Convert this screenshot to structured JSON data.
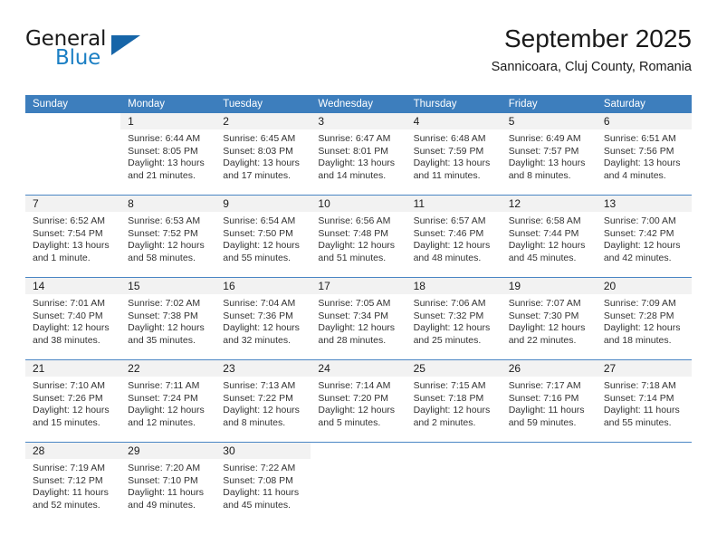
{
  "brand": {
    "word1": "General",
    "word2": "Blue",
    "logo_icon": "blue-triangle-icon",
    "accent_color": "#1b7fc4"
  },
  "header": {
    "title": "September 2025",
    "subtitle": "Sannicoara, Cluj County, Romania"
  },
  "calendar": {
    "header_color": "#3d7ebd",
    "weekdays": [
      "Sunday",
      "Monday",
      "Tuesday",
      "Wednesday",
      "Thursday",
      "Friday",
      "Saturday"
    ],
    "weeks": [
      [
        {
          "day": "",
          "sunrise": "",
          "sunset": "",
          "daylight_line1": "",
          "daylight_line2": ""
        },
        {
          "day": "1",
          "sunrise": "Sunrise: 6:44 AM",
          "sunset": "Sunset: 8:05 PM",
          "daylight_line1": "Daylight: 13 hours",
          "daylight_line2": "and 21 minutes."
        },
        {
          "day": "2",
          "sunrise": "Sunrise: 6:45 AM",
          "sunset": "Sunset: 8:03 PM",
          "daylight_line1": "Daylight: 13 hours",
          "daylight_line2": "and 17 minutes."
        },
        {
          "day": "3",
          "sunrise": "Sunrise: 6:47 AM",
          "sunset": "Sunset: 8:01 PM",
          "daylight_line1": "Daylight: 13 hours",
          "daylight_line2": "and 14 minutes."
        },
        {
          "day": "4",
          "sunrise": "Sunrise: 6:48 AM",
          "sunset": "Sunset: 7:59 PM",
          "daylight_line1": "Daylight: 13 hours",
          "daylight_line2": "and 11 minutes."
        },
        {
          "day": "5",
          "sunrise": "Sunrise: 6:49 AM",
          "sunset": "Sunset: 7:57 PM",
          "daylight_line1": "Daylight: 13 hours",
          "daylight_line2": "and 8 minutes."
        },
        {
          "day": "6",
          "sunrise": "Sunrise: 6:51 AM",
          "sunset": "Sunset: 7:56 PM",
          "daylight_line1": "Daylight: 13 hours",
          "daylight_line2": "and 4 minutes."
        }
      ],
      [
        {
          "day": "7",
          "sunrise": "Sunrise: 6:52 AM",
          "sunset": "Sunset: 7:54 PM",
          "daylight_line1": "Daylight: 13 hours",
          "daylight_line2": "and 1 minute."
        },
        {
          "day": "8",
          "sunrise": "Sunrise: 6:53 AM",
          "sunset": "Sunset: 7:52 PM",
          "daylight_line1": "Daylight: 12 hours",
          "daylight_line2": "and 58 minutes."
        },
        {
          "day": "9",
          "sunrise": "Sunrise: 6:54 AM",
          "sunset": "Sunset: 7:50 PM",
          "daylight_line1": "Daylight: 12 hours",
          "daylight_line2": "and 55 minutes."
        },
        {
          "day": "10",
          "sunrise": "Sunrise: 6:56 AM",
          "sunset": "Sunset: 7:48 PM",
          "daylight_line1": "Daylight: 12 hours",
          "daylight_line2": "and 51 minutes."
        },
        {
          "day": "11",
          "sunrise": "Sunrise: 6:57 AM",
          "sunset": "Sunset: 7:46 PM",
          "daylight_line1": "Daylight: 12 hours",
          "daylight_line2": "and 48 minutes."
        },
        {
          "day": "12",
          "sunrise": "Sunrise: 6:58 AM",
          "sunset": "Sunset: 7:44 PM",
          "daylight_line1": "Daylight: 12 hours",
          "daylight_line2": "and 45 minutes."
        },
        {
          "day": "13",
          "sunrise": "Sunrise: 7:00 AM",
          "sunset": "Sunset: 7:42 PM",
          "daylight_line1": "Daylight: 12 hours",
          "daylight_line2": "and 42 minutes."
        }
      ],
      [
        {
          "day": "14",
          "sunrise": "Sunrise: 7:01 AM",
          "sunset": "Sunset: 7:40 PM",
          "daylight_line1": "Daylight: 12 hours",
          "daylight_line2": "and 38 minutes."
        },
        {
          "day": "15",
          "sunrise": "Sunrise: 7:02 AM",
          "sunset": "Sunset: 7:38 PM",
          "daylight_line1": "Daylight: 12 hours",
          "daylight_line2": "and 35 minutes."
        },
        {
          "day": "16",
          "sunrise": "Sunrise: 7:04 AM",
          "sunset": "Sunset: 7:36 PM",
          "daylight_line1": "Daylight: 12 hours",
          "daylight_line2": "and 32 minutes."
        },
        {
          "day": "17",
          "sunrise": "Sunrise: 7:05 AM",
          "sunset": "Sunset: 7:34 PM",
          "daylight_line1": "Daylight: 12 hours",
          "daylight_line2": "and 28 minutes."
        },
        {
          "day": "18",
          "sunrise": "Sunrise: 7:06 AM",
          "sunset": "Sunset: 7:32 PM",
          "daylight_line1": "Daylight: 12 hours",
          "daylight_line2": "and 25 minutes."
        },
        {
          "day": "19",
          "sunrise": "Sunrise: 7:07 AM",
          "sunset": "Sunset: 7:30 PM",
          "daylight_line1": "Daylight: 12 hours",
          "daylight_line2": "and 22 minutes."
        },
        {
          "day": "20",
          "sunrise": "Sunrise: 7:09 AM",
          "sunset": "Sunset: 7:28 PM",
          "daylight_line1": "Daylight: 12 hours",
          "daylight_line2": "and 18 minutes."
        }
      ],
      [
        {
          "day": "21",
          "sunrise": "Sunrise: 7:10 AM",
          "sunset": "Sunset: 7:26 PM",
          "daylight_line1": "Daylight: 12 hours",
          "daylight_line2": "and 15 minutes."
        },
        {
          "day": "22",
          "sunrise": "Sunrise: 7:11 AM",
          "sunset": "Sunset: 7:24 PM",
          "daylight_line1": "Daylight: 12 hours",
          "daylight_line2": "and 12 minutes."
        },
        {
          "day": "23",
          "sunrise": "Sunrise: 7:13 AM",
          "sunset": "Sunset: 7:22 PM",
          "daylight_line1": "Daylight: 12 hours",
          "daylight_line2": "and 8 minutes."
        },
        {
          "day": "24",
          "sunrise": "Sunrise: 7:14 AM",
          "sunset": "Sunset: 7:20 PM",
          "daylight_line1": "Daylight: 12 hours",
          "daylight_line2": "and 5 minutes."
        },
        {
          "day": "25",
          "sunrise": "Sunrise: 7:15 AM",
          "sunset": "Sunset: 7:18 PM",
          "daylight_line1": "Daylight: 12 hours",
          "daylight_line2": "and 2 minutes."
        },
        {
          "day": "26",
          "sunrise": "Sunrise: 7:17 AM",
          "sunset": "Sunset: 7:16 PM",
          "daylight_line1": "Daylight: 11 hours",
          "daylight_line2": "and 59 minutes."
        },
        {
          "day": "27",
          "sunrise": "Sunrise: 7:18 AM",
          "sunset": "Sunset: 7:14 PM",
          "daylight_line1": "Daylight: 11 hours",
          "daylight_line2": "and 55 minutes."
        }
      ],
      [
        {
          "day": "28",
          "sunrise": "Sunrise: 7:19 AM",
          "sunset": "Sunset: 7:12 PM",
          "daylight_line1": "Daylight: 11 hours",
          "daylight_line2": "and 52 minutes."
        },
        {
          "day": "29",
          "sunrise": "Sunrise: 7:20 AM",
          "sunset": "Sunset: 7:10 PM",
          "daylight_line1": "Daylight: 11 hours",
          "daylight_line2": "and 49 minutes."
        },
        {
          "day": "30",
          "sunrise": "Sunrise: 7:22 AM",
          "sunset": "Sunset: 7:08 PM",
          "daylight_line1": "Daylight: 11 hours",
          "daylight_line2": "and 45 minutes."
        },
        {
          "day": "",
          "sunrise": "",
          "sunset": "",
          "daylight_line1": "",
          "daylight_line2": ""
        },
        {
          "day": "",
          "sunrise": "",
          "sunset": "",
          "daylight_line1": "",
          "daylight_line2": ""
        },
        {
          "day": "",
          "sunrise": "",
          "sunset": "",
          "daylight_line1": "",
          "daylight_line2": ""
        },
        {
          "day": "",
          "sunrise": "",
          "sunset": "",
          "daylight_line1": "",
          "daylight_line2": ""
        }
      ]
    ]
  }
}
